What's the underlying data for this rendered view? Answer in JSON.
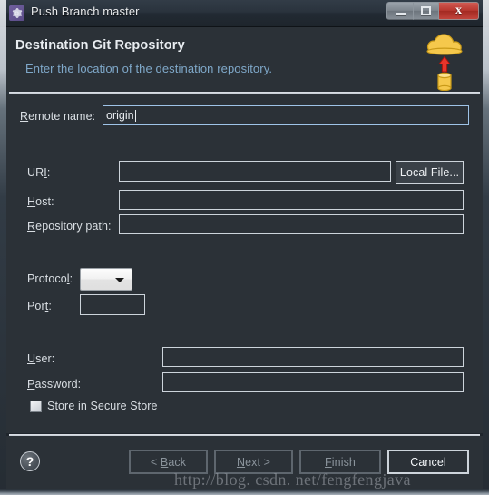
{
  "window": {
    "title": "Push Branch master",
    "icon": "gear-icon",
    "controls": {
      "minimize": "–",
      "maximize": "□",
      "close": "x"
    }
  },
  "header": {
    "title": "Destination Git Repository",
    "subtitle": "Enter the location of the destination repository.",
    "art": "push-to-cloud-icon"
  },
  "form": {
    "remote_name": {
      "label_prefix": "",
      "label_mnemonic": "R",
      "label_rest": "emote name:",
      "value": "origin",
      "placeholder": ""
    },
    "uri": {
      "label_pre": "UR",
      "label_mnemonic": "I",
      "label_post": ":",
      "value": "",
      "placeholder": ""
    },
    "local_file_button": "Local File...",
    "host": {
      "label_mnemonic": "H",
      "label_rest": "ost:",
      "value": "",
      "placeholder": ""
    },
    "repository_path": {
      "label_mnemonic": "R",
      "label_rest": "epository path:",
      "value": "",
      "placeholder": ""
    },
    "protocol": {
      "label_pre": "Protoco",
      "label_mnemonic": "l",
      "label_post": ":",
      "selected": "",
      "options": []
    },
    "port": {
      "label_pre": "Por",
      "label_mnemonic": "t",
      "label_post": ":",
      "value": "",
      "placeholder": ""
    },
    "user": {
      "label_mnemonic": "U",
      "label_rest": "ser:",
      "value": "",
      "placeholder": ""
    },
    "password": {
      "label_mnemonic": "P",
      "label_rest": "assword:",
      "value": "",
      "placeholder": ""
    },
    "store_secure": {
      "label_pre": "",
      "label_mnemonic": "S",
      "label_rest": "tore in Secure Store",
      "checked": false
    }
  },
  "footer": {
    "help": "?",
    "back": {
      "pre": "< ",
      "mnemonic": "B",
      "post": "ack",
      "enabled": false
    },
    "next": {
      "pre": "",
      "mnemonic": "N",
      "post": "ext >",
      "enabled": false
    },
    "finish": {
      "pre": "",
      "mnemonic": "F",
      "post": "inish",
      "enabled": false
    },
    "cancel": {
      "pre": "",
      "mnemonic": "",
      "post": "Cancel",
      "enabled": true
    }
  },
  "watermark": "http://blog. csdn. net/fengfengjava",
  "colors": {
    "background": "#2b3137",
    "titlebar": "#2a333d",
    "accent_link": "#7fa8c9",
    "field_border": "#cdd4db",
    "focus_border": "#9fc4e8",
    "close_button": "#b83830",
    "cloud": "#f2c34a",
    "arrow": "#e03b30"
  }
}
